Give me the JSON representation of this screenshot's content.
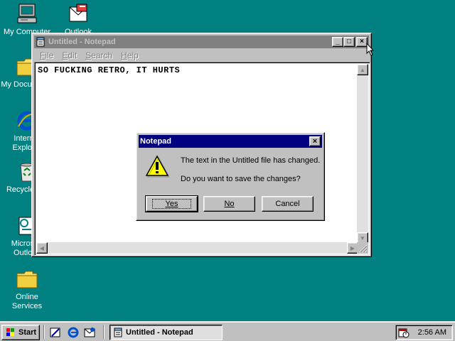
{
  "desktop": {
    "icons": [
      {
        "label": "My Computer",
        "icon": "my-computer-icon"
      },
      {
        "label": "Outlook",
        "icon": "outlook-icon"
      },
      {
        "label": "My Documents",
        "icon": "folder-icon"
      },
      {
        "label": "Internet Explorer",
        "icon": "internet-explorer-icon"
      },
      {
        "label": "Recycle Bin",
        "icon": "recycle-bin-icon"
      },
      {
        "label": "Microsoft Outlook",
        "icon": "outlook-setup-icon"
      },
      {
        "label": "Online Services",
        "icon": "folder-icon"
      }
    ]
  },
  "notepad": {
    "title": "Untitled - Notepad",
    "menu": [
      {
        "label": "File",
        "accel": "F",
        "rest": "ile"
      },
      {
        "label": "Edit",
        "accel": "E",
        "rest": "dit"
      },
      {
        "label": "Search",
        "accel": "S",
        "rest": "earch"
      },
      {
        "label": "Help",
        "accel": "H",
        "rest": "elp"
      }
    ],
    "content": "SO FUCKING RETRO, IT HURTS",
    "buttons": {
      "minimize": "_",
      "maximize": "□",
      "close": "×"
    }
  },
  "dialog": {
    "title": "Notepad",
    "message1": "The text in the Untitled file has changed.",
    "message2": "Do you want to save the changes?",
    "yes_label": "Yes",
    "no_label": "No",
    "cancel_label": "Cancel",
    "close_glyph": "×"
  },
  "taskbar": {
    "start_label": "Start",
    "task_label": "Untitled - Notepad",
    "clock": "2:56 AM"
  }
}
